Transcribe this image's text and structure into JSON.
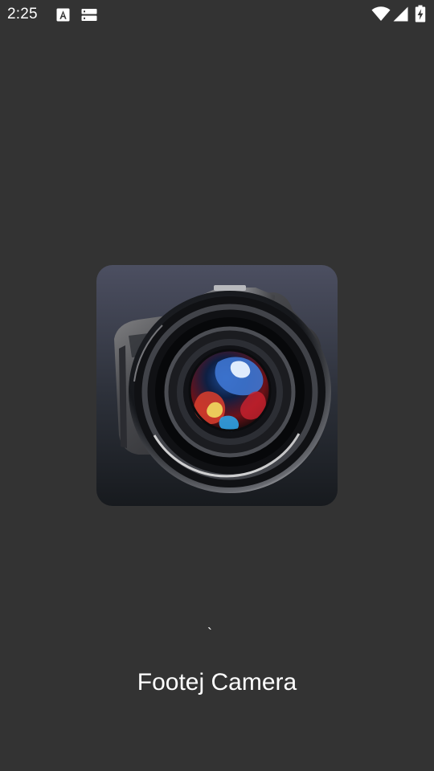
{
  "colors": {
    "background": "#333333",
    "status_text": "#ffffff",
    "title_text": "#ffffff"
  },
  "status_bar": {
    "time": "2:25",
    "icons": [
      "text-notification-icon",
      "storage-notification-icon",
      "wifi-icon",
      "cellular-signal-icon",
      "battery-charging-icon"
    ]
  },
  "splash": {
    "app_icon": "camera-lens-icon",
    "progress_mark": "`",
    "app_name": "Footej Camera"
  }
}
